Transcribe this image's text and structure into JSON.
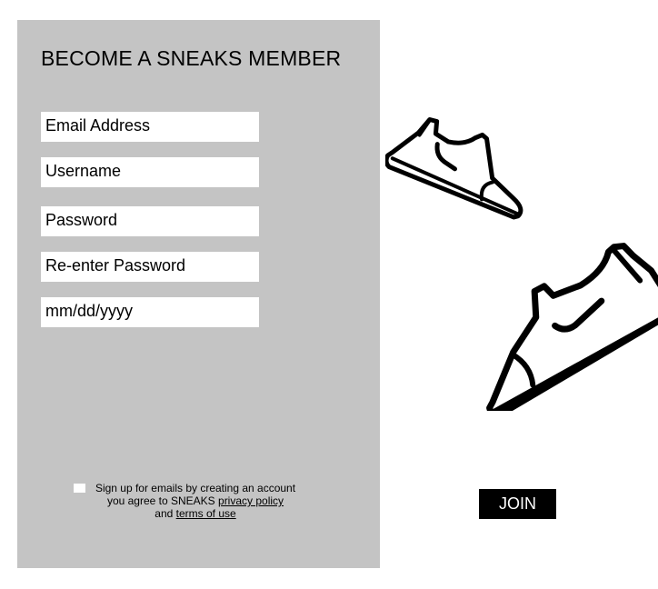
{
  "form": {
    "title": "BECOME A SNEAKS MEMBER",
    "fields": [
      {
        "placeholder": "Email Address"
      },
      {
        "placeholder": "Username"
      },
      {
        "placeholder": "Password"
      },
      {
        "placeholder": "Re-enter Password"
      },
      {
        "placeholder": "mm/dd/yyyy"
      }
    ],
    "consent": {
      "checked": false,
      "line1": "Sign up for emails by creating an account",
      "line2_prefix": "you agree to SNEAKS ",
      "privacy_link": "privacy policy",
      "line3_prefix": "and ",
      "terms_link": "terms of use"
    },
    "panel_color": "#c4c4c4"
  },
  "join_button": {
    "label": "JOIN",
    "color": "#000000"
  },
  "illustrations": [
    {
      "icon": "sneaker-icon"
    },
    {
      "icon": "sneaker-icon"
    }
  ]
}
